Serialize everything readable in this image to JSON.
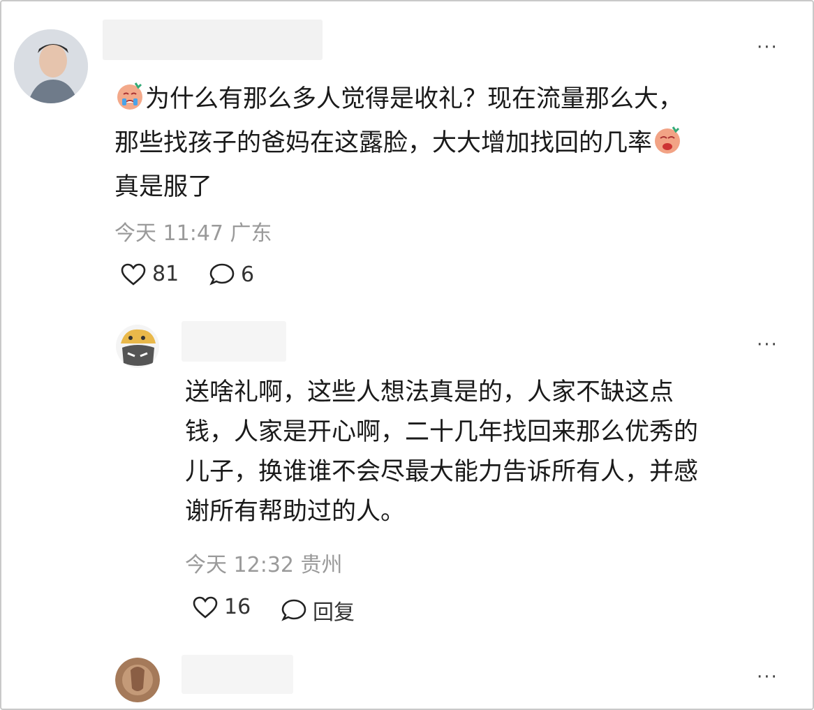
{
  "comments": [
    {
      "body_lines": [
        "为什么有那么多人觉得是收礼？现在流量那么大，",
        "那些找孩子的爸妈在这露脸，大大增加找回的几率",
        "真是服了"
      ],
      "time": "今天 11:47 广东",
      "likes": "81",
      "replies": "6",
      "more": "···"
    },
    {
      "body_lines": [
        "送啥礼啊，这些人想法真是的，人家不缺这点",
        "钱，人家是开心啊，二十几年找回来那么优秀的",
        "儿子，换谁谁不会尽最大能力告诉所有人，并感",
        "谢所有帮助过的人。"
      ],
      "time": "今天 12:32 贵州",
      "likes": "16",
      "reply_label": "回复",
      "more": "···"
    },
    {
      "more": "···"
    }
  ],
  "icons": {
    "like": "heart-icon",
    "comment": "speech-bubble-icon",
    "emoji_cry": "crying-face-emoji",
    "emoji_sob": "sobbing-face-emoji"
  }
}
